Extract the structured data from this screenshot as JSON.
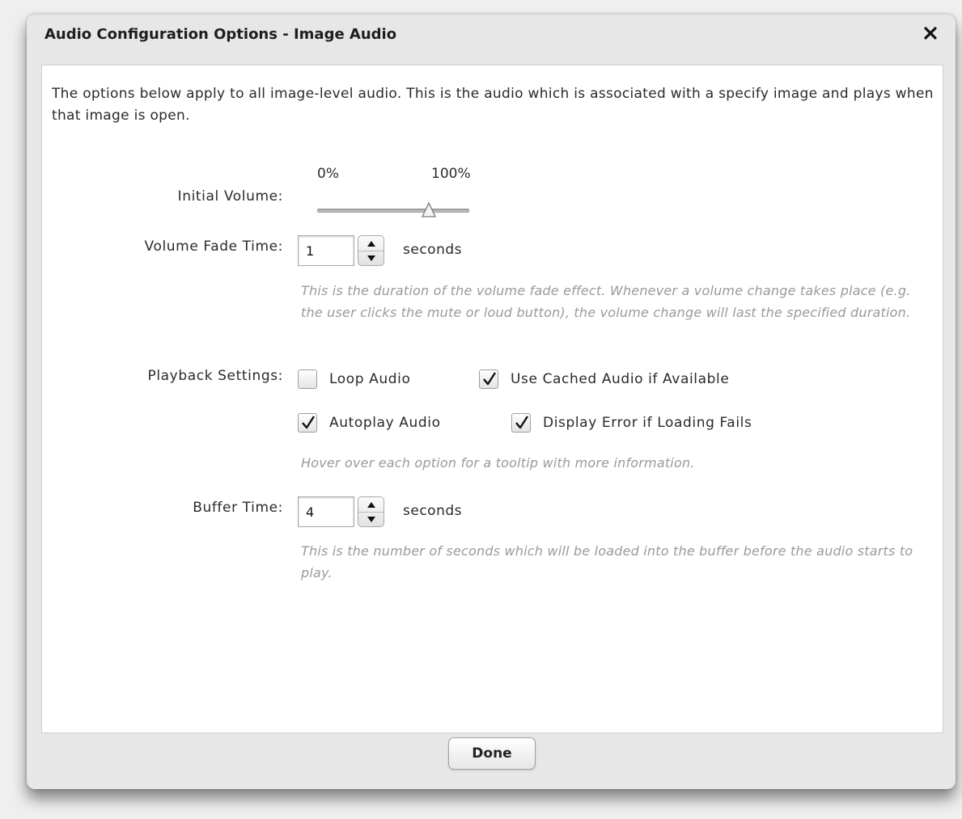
{
  "dialog": {
    "title": "Audio Configuration Options - Image Audio",
    "close_glyph": "✕",
    "intro": "The options below apply to all image-level audio.  This is the audio which is associated with a specify image and plays when that image is open."
  },
  "volume": {
    "label": "Initial Volume:",
    "min_label": "0%",
    "max_label": "100%",
    "value_fraction": 0.74
  },
  "fade": {
    "label": "Volume Fade Time:",
    "value": "1",
    "unit": "seconds",
    "help": "This is the duration of the volume fade effect.  Whenever a volume change takes place (e.g. the user clicks the mute or loud button), the volume change will last the specified duration."
  },
  "playback": {
    "label": "Playback Settings:",
    "options": [
      {
        "label": "Loop Audio",
        "checked": false
      },
      {
        "label": "Use Cached Audio if Available",
        "checked": true
      },
      {
        "label": "Autoplay Audio",
        "checked": true
      },
      {
        "label": "Display Error if Loading Fails",
        "checked": true
      }
    ],
    "help": "Hover over each option for a tooltip with more information."
  },
  "buffer": {
    "label": "Buffer Time:",
    "value": "4",
    "unit": "seconds",
    "help": "This is the number of seconds which will be loaded into the buffer before the audio starts to play."
  },
  "footer": {
    "done_label": "Done"
  }
}
